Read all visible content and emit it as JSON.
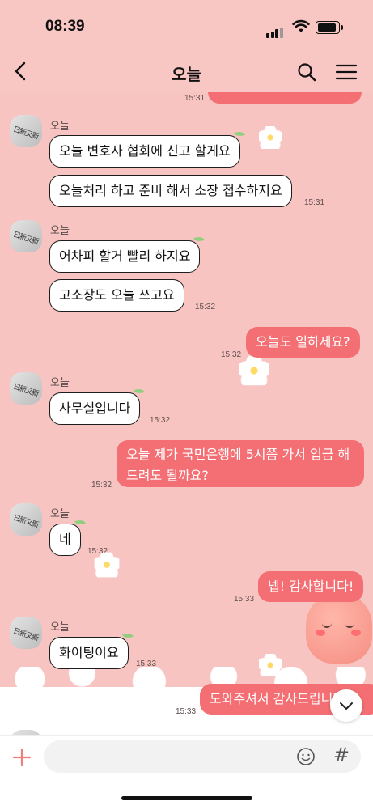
{
  "status": {
    "time": "08:39"
  },
  "header": {
    "title": "오늘"
  },
  "colors": {
    "background": "#f7c4c1",
    "my_bubble": "#f36f73",
    "their_bubble": "#ffffff"
  },
  "avatar_text": "日新又新",
  "messages": [
    {
      "sender": "me",
      "text": "",
      "time": "15:31"
    },
    {
      "sender": "오늘",
      "text": "오늘 변호사 협회에 신고 할게요"
    },
    {
      "sender": "오늘",
      "text": "오늘처리 하고 준비 해서 소장 접수하지요",
      "time": "15:31"
    },
    {
      "sender": "오늘",
      "text": "어차피 할거 빨리 하지요"
    },
    {
      "sender": "오늘",
      "text": "고소장도 오늘 쓰고요",
      "time": "15:32"
    },
    {
      "sender": "me",
      "text": "오늘도 일하세요?",
      "time": "15:32"
    },
    {
      "sender": "오늘",
      "text": "사무실입니다",
      "time": "15:32"
    },
    {
      "sender": "me",
      "text_lines": [
        "오늘 제가 국민은행에 5시쯤 가서 입금 해",
        "드려도 될까요?"
      ],
      "time": "15:32"
    },
    {
      "sender": "오늘",
      "text": "네",
      "time": "15:32"
    },
    {
      "sender": "me",
      "text": "넵! 감사합니다!",
      "time": "15:33"
    },
    {
      "sender": "오늘",
      "text": "화이팅이요",
      "time": "15:33"
    },
    {
      "sender": "me",
      "text": "도와주셔서 감사드립니다",
      "time": "15:33"
    }
  ],
  "input": {
    "placeholder": ""
  }
}
